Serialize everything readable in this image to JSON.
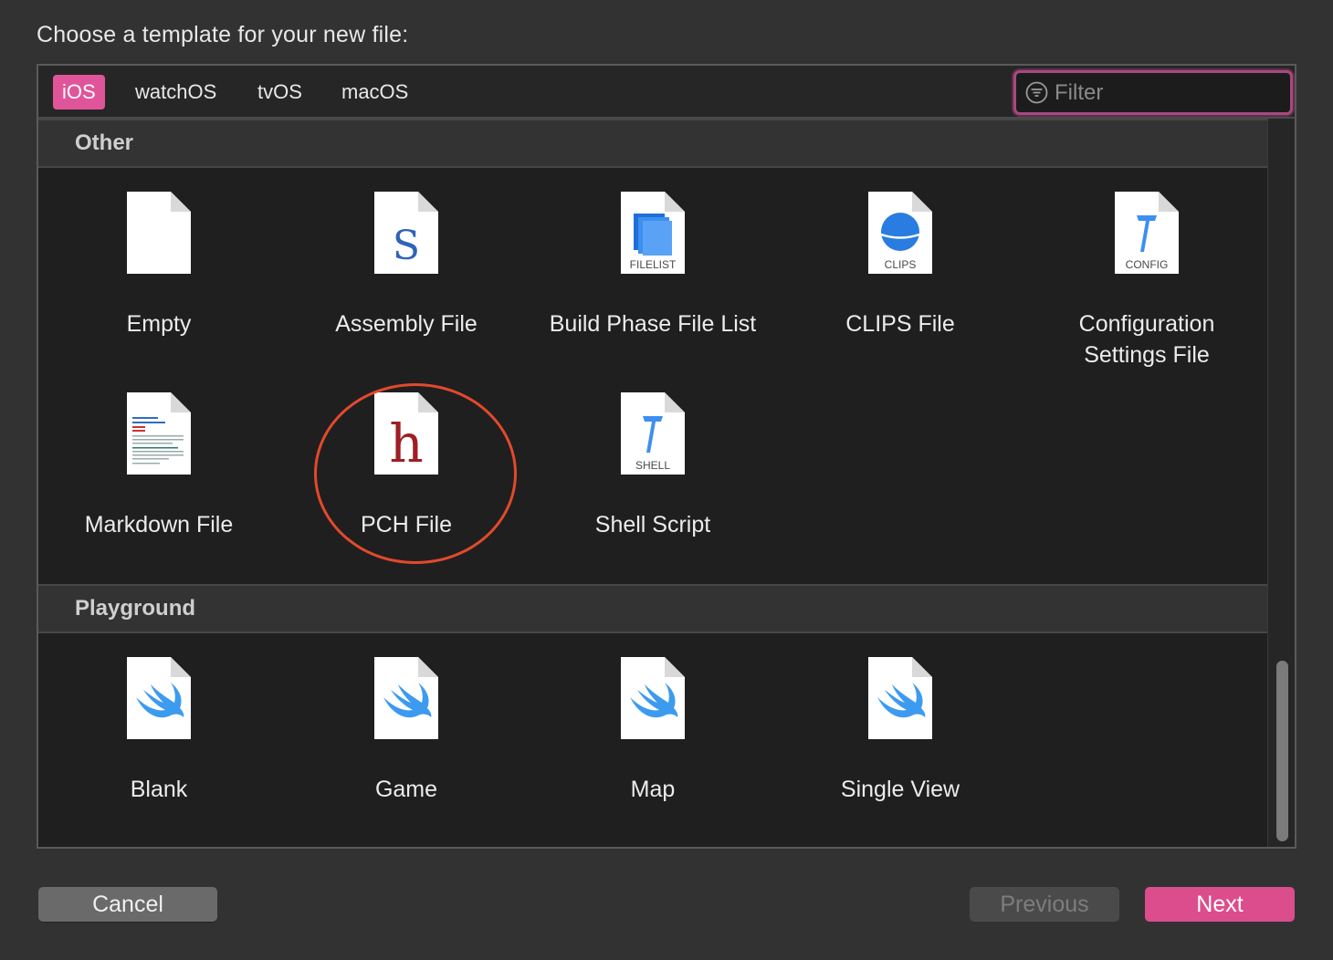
{
  "prompt": "Choose a template for your new file:",
  "tabs": [
    {
      "label": "iOS",
      "active": true
    },
    {
      "label": "watchOS",
      "active": false
    },
    {
      "label": "tvOS",
      "active": false
    },
    {
      "label": "macOS",
      "active": false
    }
  ],
  "filter": {
    "placeholder": "Filter",
    "value": "",
    "icon": "filter-icon"
  },
  "sections": [
    {
      "title": "Other",
      "items": [
        {
          "label": "Empty",
          "icon": "empty-file-icon"
        },
        {
          "label": "Assembly File",
          "icon": "assembly-file-icon",
          "glyph": "S"
        },
        {
          "label": "Build Phase File List",
          "icon": "filelist-file-icon",
          "caption": "FILELIST"
        },
        {
          "label": "CLIPS File",
          "icon": "clips-file-icon",
          "caption": "CLIPS"
        },
        {
          "label": "Configuration Settings File",
          "icon": "config-file-icon",
          "caption": "CONFIG"
        },
        {
          "label": "Markdown File",
          "icon": "markdown-file-icon"
        },
        {
          "label": "PCH File",
          "icon": "pch-file-icon",
          "glyph": "h"
        },
        {
          "label": "Shell Script",
          "icon": "shell-file-icon",
          "caption": "SHELL"
        }
      ]
    },
    {
      "title": "Playground",
      "items": [
        {
          "label": "Blank",
          "icon": "swift-playground-icon"
        },
        {
          "label": "Game",
          "icon": "swift-playground-icon"
        },
        {
          "label": "Map",
          "icon": "swift-playground-icon"
        },
        {
          "label": "Single View",
          "icon": "swift-playground-icon"
        }
      ]
    }
  ],
  "buttons": {
    "cancel": "Cancel",
    "previous": "Previous",
    "next": "Next"
  },
  "colors": {
    "accent": "#e0559a",
    "next_button": "#dc4d8d",
    "annotation": "#e2492d",
    "swift": "#3d9bef"
  }
}
